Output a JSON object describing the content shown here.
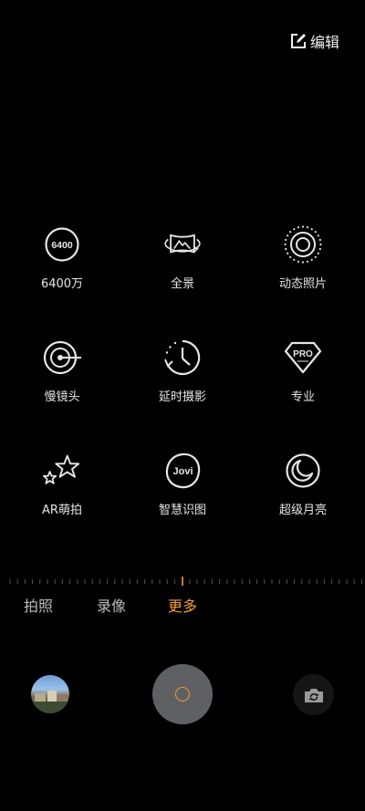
{
  "header": {
    "edit_label": "编辑"
  },
  "modes": [
    {
      "label": "6400万",
      "icon": "6400-megapixel-icon",
      "badge": "6400"
    },
    {
      "label": "全景",
      "icon": "panorama-icon"
    },
    {
      "label": "动态照片",
      "icon": "live-photo-icon"
    },
    {
      "label": "慢镜头",
      "icon": "slow-motion-icon"
    },
    {
      "label": "延时摄影",
      "icon": "timelapse-icon"
    },
    {
      "label": "专业",
      "icon": "pro-mode-icon",
      "badge": "PRO"
    },
    {
      "label": "AR萌拍",
      "icon": "ar-stars-icon"
    },
    {
      "label": "智慧识图",
      "icon": "jovi-lens-icon",
      "badge": "Jovi"
    },
    {
      "label": "超级月亮",
      "icon": "super-moon-icon"
    }
  ],
  "tabs": [
    {
      "label": "拍照",
      "active": false
    },
    {
      "label": "录像",
      "active": false
    },
    {
      "label": "更多",
      "active": true
    }
  ],
  "colors": {
    "accent": "#f59a3c",
    "background": "#000000",
    "shutter": "#5f6063"
  }
}
